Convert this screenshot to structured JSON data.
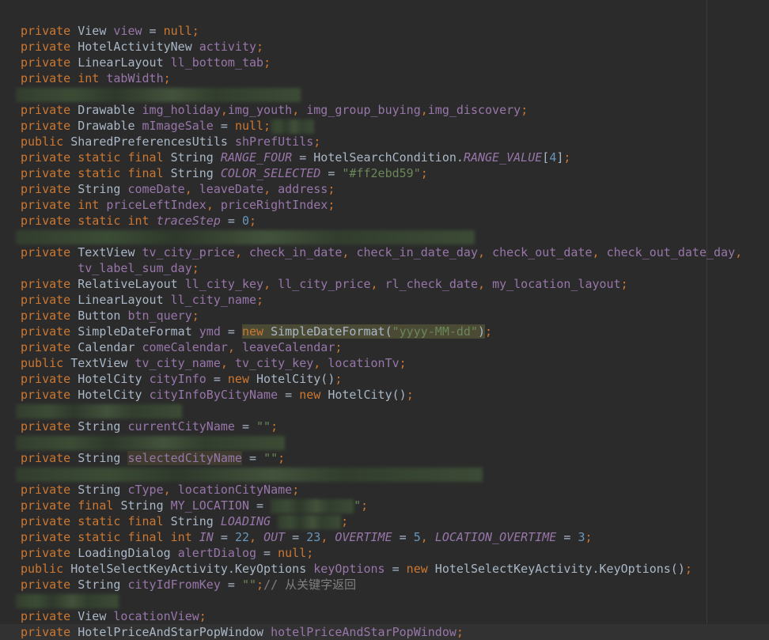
{
  "editor": {
    "theme_colors": {
      "background": "#2b2b2b",
      "keyword": "#cc7832",
      "text": "#a9b7c6",
      "field": "#9876aa",
      "string": "#6a8759",
      "number": "#6897bb"
    },
    "lines": [
      [
        [
          "k",
          "private "
        ],
        [
          "t",
          "View "
        ],
        [
          "f",
          "view"
        ],
        [
          "t",
          " = "
        ],
        [
          "k",
          "null;"
        ]
      ],
      [
        [
          "k",
          "private "
        ],
        [
          "t",
          "HotelActivityNew "
        ],
        [
          "f",
          "activity"
        ],
        [
          "k",
          ";"
        ]
      ],
      [
        [
          "k",
          "private "
        ],
        [
          "t",
          "LinearLayout "
        ],
        [
          "f",
          "ll_bottom_tab"
        ],
        [
          "k",
          ";"
        ]
      ],
      [
        [
          "k",
          "private int "
        ],
        [
          "f",
          "tabWidth"
        ],
        [
          "k",
          ";"
        ]
      ],
      [
        [
          "blur",
          ""
        ]
      ],
      [
        [
          "k",
          "private "
        ],
        [
          "t",
          "Drawable "
        ],
        [
          "f",
          "img_holiday"
        ],
        [
          "k",
          ","
        ],
        [
          "f",
          "img_youth"
        ],
        [
          "k",
          ", "
        ],
        [
          "f",
          "img_group_buying"
        ],
        [
          "k",
          ","
        ],
        [
          "f",
          "img_discovery"
        ],
        [
          "k",
          ";"
        ]
      ],
      [
        [
          "k",
          "private "
        ],
        [
          "t",
          "Drawable "
        ],
        [
          "f",
          "mImageSale"
        ],
        [
          "t",
          " = "
        ],
        [
          "k",
          "null;"
        ],
        [
          "blur",
          ""
        ]
      ],
      [
        [
          "k",
          "public "
        ],
        [
          "t",
          "SharedPreferencesUtils "
        ],
        [
          "f",
          "shPrefUtils"
        ],
        [
          "k",
          ";"
        ]
      ],
      [
        [
          "k",
          "private static final "
        ],
        [
          "t",
          "String "
        ],
        [
          "fi",
          "RANGE_FOUR"
        ],
        [
          "t",
          " = HotelSearchCondition."
        ],
        [
          "fi",
          "RANGE_VALUE"
        ],
        [
          "t",
          "["
        ],
        [
          "n",
          "4"
        ],
        [
          "t",
          "]"
        ],
        [
          "k",
          ";"
        ]
      ],
      [
        [
          "k",
          "private static final "
        ],
        [
          "t",
          "String "
        ],
        [
          "fi",
          "COLOR_SELECTED"
        ],
        [
          "t",
          " = "
        ],
        [
          "s",
          "\"#ff2ebd59\""
        ],
        [
          "k",
          ";"
        ]
      ],
      [
        [
          "k",
          "private "
        ],
        [
          "t",
          "String "
        ],
        [
          "f",
          "comeDate"
        ],
        [
          "k",
          ", "
        ],
        [
          "f",
          "leaveDate"
        ],
        [
          "k",
          ", "
        ],
        [
          "f",
          "address"
        ],
        [
          "k",
          ";"
        ]
      ],
      [
        [
          "k",
          "private int "
        ],
        [
          "f",
          "priceLeftIndex"
        ],
        [
          "k",
          ", "
        ],
        [
          "f",
          "priceRightIndex"
        ],
        [
          "k",
          ";"
        ]
      ],
      [
        [
          "k",
          "private static int "
        ],
        [
          "fi",
          "traceStep"
        ],
        [
          "t",
          " = "
        ],
        [
          "n",
          "0"
        ],
        [
          "k",
          ";"
        ]
      ],
      [
        [
          "blur",
          ""
        ]
      ],
      [
        [
          "k",
          "private "
        ],
        [
          "t",
          "TextView "
        ],
        [
          "f",
          "tv_city_price"
        ],
        [
          "k",
          ", "
        ],
        [
          "f",
          "check_in_date"
        ],
        [
          "k",
          ", "
        ],
        [
          "f",
          "check_in_date_day"
        ],
        [
          "k",
          ", "
        ],
        [
          "f",
          "check_out_date"
        ],
        [
          "k",
          ", "
        ],
        [
          "f",
          "check_out_date_day"
        ],
        [
          "k",
          ","
        ]
      ],
      [
        [
          "t",
          "        "
        ],
        [
          "f",
          "tv_label_sum_day"
        ],
        [
          "k",
          ";"
        ]
      ],
      [
        [
          "k",
          "private "
        ],
        [
          "t",
          "RelativeLayout "
        ],
        [
          "f",
          "ll_city_key"
        ],
        [
          "k",
          ", "
        ],
        [
          "f",
          "ll_city_price"
        ],
        [
          "k",
          ", "
        ],
        [
          "f",
          "rl_check_date"
        ],
        [
          "k",
          ", "
        ],
        [
          "f",
          "my_location_layout"
        ],
        [
          "k",
          ";"
        ]
      ],
      [
        [
          "k",
          "private "
        ],
        [
          "t",
          "LinearLayout "
        ],
        [
          "f",
          "ll_city_name"
        ],
        [
          "k",
          ";"
        ]
      ],
      [
        [
          "k",
          "private "
        ],
        [
          "t",
          "Button "
        ],
        [
          "f",
          "btn_query"
        ],
        [
          "k",
          ";"
        ]
      ],
      [
        [
          "k",
          "private "
        ],
        [
          "t",
          "SimpleDateFormat "
        ],
        [
          "f",
          "ymd"
        ],
        [
          "t",
          " = "
        ],
        [
          "k hl",
          "new "
        ],
        [
          "t hl",
          "SimpleDateFormat("
        ],
        [
          "s hl",
          "\"yyyy-MM-dd\""
        ],
        [
          "t hl",
          ")"
        ],
        [
          "k",
          ";"
        ]
      ],
      [
        [
          "k",
          "private "
        ],
        [
          "t",
          "Calendar "
        ],
        [
          "f",
          "comeCalendar"
        ],
        [
          "k",
          ", "
        ],
        [
          "f",
          "leaveCalendar"
        ],
        [
          "k",
          ";"
        ]
      ],
      [
        [
          "k",
          "public "
        ],
        [
          "t",
          "TextView "
        ],
        [
          "f",
          "tv_city_name"
        ],
        [
          "k",
          ", "
        ],
        [
          "f",
          "tv_city_key"
        ],
        [
          "k",
          ", "
        ],
        [
          "f",
          "locationTv"
        ],
        [
          "k",
          ";"
        ]
      ],
      [
        [
          "k",
          "private "
        ],
        [
          "t",
          "HotelCity "
        ],
        [
          "f",
          "cityInfo"
        ],
        [
          "t",
          " = "
        ],
        [
          "k",
          "new "
        ],
        [
          "t",
          "HotelCity()"
        ],
        [
          "k",
          ";"
        ]
      ],
      [
        [
          "k",
          "private "
        ],
        [
          "t",
          "HotelCity "
        ],
        [
          "f",
          "cityInfoByCityName"
        ],
        [
          "t",
          " = "
        ],
        [
          "k",
          "new "
        ],
        [
          "t",
          "HotelCity()"
        ],
        [
          "k",
          ";"
        ]
      ],
      [
        [
          "blur",
          ""
        ]
      ],
      [
        [
          "k",
          "private "
        ],
        [
          "t",
          "String "
        ],
        [
          "f",
          "currentCityName"
        ],
        [
          "t",
          " = "
        ],
        [
          "s",
          "\"\""
        ],
        [
          "k",
          ";"
        ]
      ],
      [
        [
          "blur",
          ""
        ]
      ],
      [
        [
          "k",
          "private "
        ],
        [
          "t",
          "String "
        ],
        [
          "f hl2",
          "selectedCityName"
        ],
        [
          "t",
          " = "
        ],
        [
          "s",
          "\"\""
        ],
        [
          "k",
          ";"
        ]
      ],
      [
        [
          "blur",
          ""
        ]
      ],
      [
        [
          "k",
          "private "
        ],
        [
          "t",
          "String "
        ],
        [
          "f",
          "cType"
        ],
        [
          "k",
          ", "
        ],
        [
          "f",
          "locationCityName"
        ],
        [
          "k",
          ";"
        ]
      ],
      [
        [
          "k",
          "private final "
        ],
        [
          "t",
          "String "
        ],
        [
          "f",
          "MY_LOCATION"
        ],
        [
          "t",
          " = "
        ],
        [
          "blur",
          ""
        ],
        [
          "s",
          "\""
        ],
        [
          "k",
          ";"
        ]
      ],
      [
        [
          "k",
          "private static final "
        ],
        [
          "t",
          "String "
        ],
        [
          "fi",
          "LOADING"
        ],
        [
          "t",
          " "
        ],
        [
          "blur",
          ""
        ],
        [
          "k",
          ";"
        ]
      ],
      [
        [
          "k",
          "private static final int "
        ],
        [
          "fi",
          "IN"
        ],
        [
          "t",
          " = "
        ],
        [
          "n",
          "22"
        ],
        [
          "k",
          ", "
        ],
        [
          "fi",
          "OUT"
        ],
        [
          "t",
          " = "
        ],
        [
          "n",
          "23"
        ],
        [
          "k",
          ", "
        ],
        [
          "fi",
          "OVERTIME"
        ],
        [
          "t",
          " = "
        ],
        [
          "n",
          "5"
        ],
        [
          "k",
          ", "
        ],
        [
          "fi",
          "LOCATION_OVERTIME"
        ],
        [
          "t",
          " = "
        ],
        [
          "n",
          "3"
        ],
        [
          "k",
          ";"
        ]
      ],
      [
        [
          "k",
          "private "
        ],
        [
          "t",
          "LoadingDialog "
        ],
        [
          "f",
          "alertDialog"
        ],
        [
          "t",
          " = "
        ],
        [
          "k",
          "null;"
        ]
      ],
      [
        [
          "k",
          "public "
        ],
        [
          "t",
          "HotelSelectKeyActivity.KeyOptions "
        ],
        [
          "f",
          "keyOptions"
        ],
        [
          "t",
          " = "
        ],
        [
          "k",
          "new "
        ],
        [
          "t",
          "HotelSelectKeyActivity.KeyOptions()"
        ],
        [
          "k",
          ";"
        ]
      ],
      [
        [
          "k",
          "private "
        ],
        [
          "t",
          "String "
        ],
        [
          "f",
          "cityIdFromKey"
        ],
        [
          "t",
          " = "
        ],
        [
          "s",
          "\"\""
        ],
        [
          "k",
          ";"
        ],
        [
          "c",
          "// 从关键字返回"
        ]
      ],
      [
        [
          "blur",
          ""
        ]
      ],
      [
        [
          "k",
          "private "
        ],
        [
          "t",
          "View "
        ],
        [
          "f",
          "locationView"
        ],
        [
          "k",
          ";"
        ]
      ],
      [
        [
          "k",
          "private "
        ],
        [
          "t",
          "HotelPriceAndStarPopWindow "
        ],
        [
          "f",
          "hotelPriceAndStarPopWindow"
        ],
        [
          "k",
          ";"
        ]
      ]
    ]
  }
}
